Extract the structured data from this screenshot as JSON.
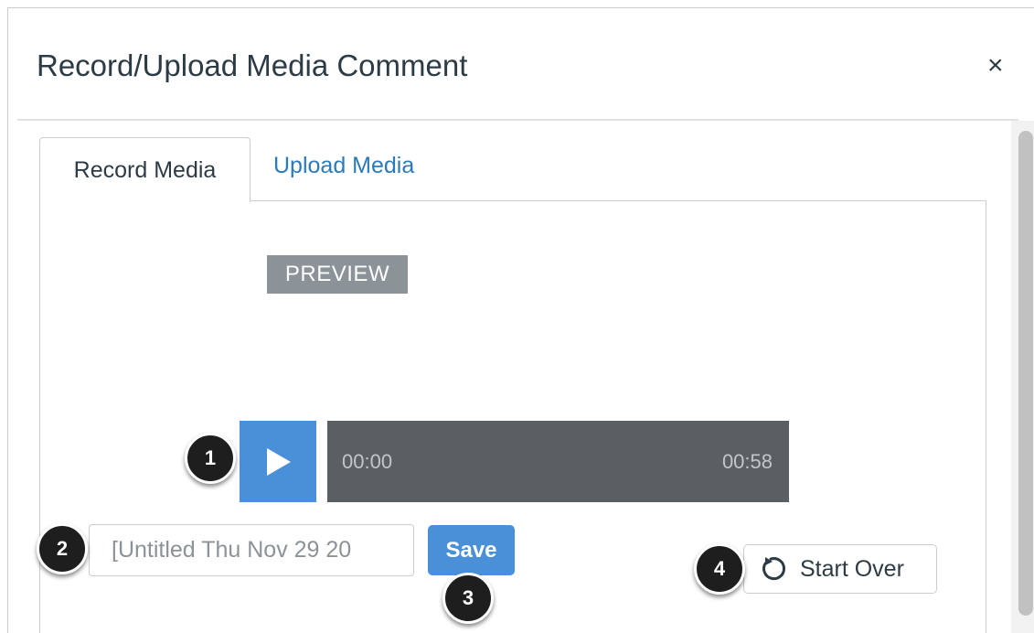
{
  "dialog": {
    "title": "Record/Upload Media Comment",
    "close_label": "×"
  },
  "tabs": [
    {
      "label": "Record Media",
      "active": true
    },
    {
      "label": "Upload Media",
      "active": false
    }
  ],
  "player": {
    "preview_label": "PREVIEW",
    "play_icon": "play-icon",
    "current_time": "00:00",
    "duration": "00:58"
  },
  "form": {
    "title_placeholder": "[Untitled Thu Nov 29 20",
    "save_label": "Save",
    "start_over_label": "Start Over",
    "start_over_icon": "refresh-icon"
  },
  "callouts": [
    "1",
    "2",
    "3",
    "4"
  ],
  "colors": {
    "accent": "#4a90d9",
    "link": "#2a7abc",
    "player_bar": "#5a5f63",
    "preview_bg": "#8b9399",
    "callout_bg": "#1e1e1e"
  }
}
